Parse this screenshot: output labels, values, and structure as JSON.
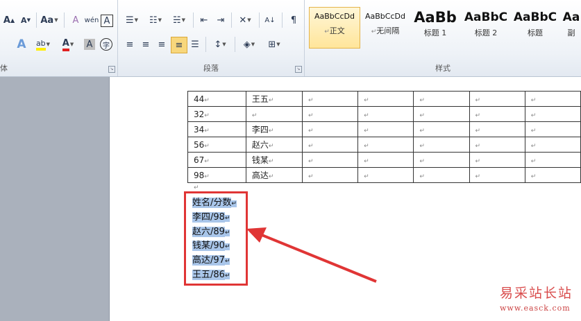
{
  "ribbon": {
    "groups": {
      "font_label": "体",
      "paragraph_label": "段落",
      "styles_label": "样式"
    },
    "font_buttons": {
      "grow": "A",
      "shrink": "A",
      "case": "Aa",
      "clear_format": "A",
      "phonetic": "wén",
      "border_char": "A",
      "text_effect": "A",
      "highlight": "ab",
      "font_color": "A",
      "shading": "A",
      "enclose": "字"
    },
    "styles": [
      {
        "sample": "AaBbCcDd",
        "label": "正文",
        "selected": true
      },
      {
        "sample": "AaBbCcDd",
        "label": "无间隔",
        "selected": false
      },
      {
        "sample": "AaBb",
        "label": "标题 1",
        "selected": false
      },
      {
        "sample": "AaBbC",
        "label": "标题 2",
        "selected": false
      },
      {
        "sample": "AaBbC",
        "label": "标题",
        "selected": false
      },
      {
        "sample": "Aa",
        "label": "副",
        "selected": false
      }
    ],
    "icons": [
      "grow-font-icon",
      "shrink-font-icon",
      "change-case-icon",
      "clear-format-icon",
      "phonetic-guide-icon",
      "char-border-icon",
      "text-effect-icon",
      "highlight-icon",
      "font-color-icon",
      "char-shading-icon",
      "enclose-char-icon",
      "bullets-icon",
      "numbering-icon",
      "multilevel-list-icon",
      "decrease-indent-icon",
      "increase-indent-icon",
      "chinese-layout-icon",
      "sort-icon",
      "show-marks-icon",
      "align-left-icon",
      "align-center-icon",
      "align-right-icon",
      "justify-icon",
      "distributed-icon",
      "line-spacing-icon",
      "paragraph-shading-icon",
      "borders-icon"
    ]
  },
  "document": {
    "table_rows": [
      [
        "44",
        "王五"
      ],
      [
        "32",
        ""
      ],
      [
        "34",
        "李四"
      ],
      [
        "56",
        "赵六"
      ],
      [
        "67",
        "钱某"
      ],
      [
        "98",
        "高达"
      ]
    ],
    "list_lines": [
      "姓名/分数",
      "李四/98",
      "赵六/89",
      "钱某/90",
      "高达/97",
      "王五/86"
    ],
    "para_mark": "↵"
  },
  "watermark": {
    "title": "易采站长站",
    "url": "www.easck.com"
  },
  "colors": {
    "highlight": "#a9c6ea",
    "annotation_red": "#e03535",
    "selected_style": "#ffe59a"
  }
}
